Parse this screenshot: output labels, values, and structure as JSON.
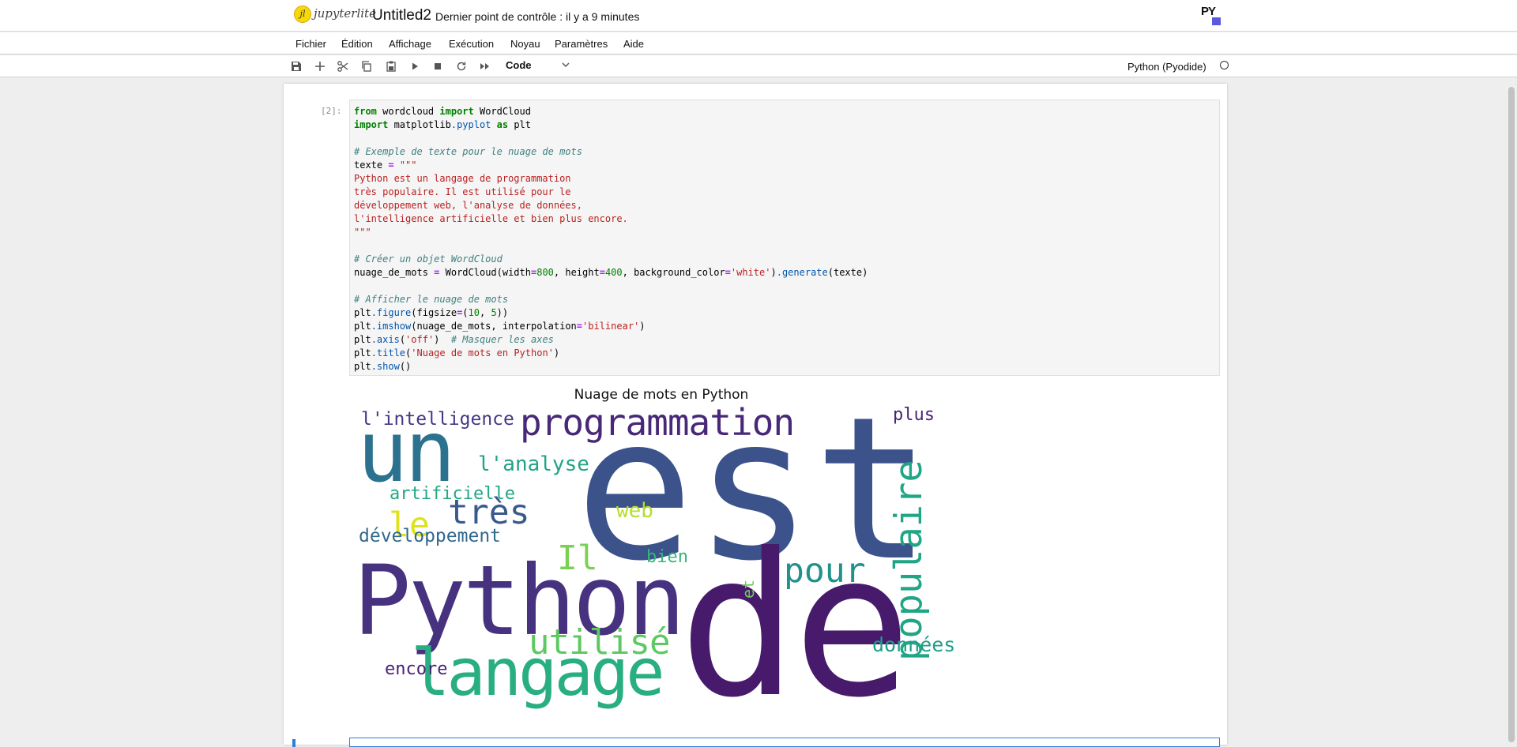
{
  "app": {
    "logo_text": "jupyterlite",
    "doc_title": "Untitled2",
    "checkpoint": "Dernier point de contrôle : il y a 9 minutes",
    "py_logo": "PY"
  },
  "menu": [
    "Fichier",
    "Édition",
    "Affichage",
    "Exécution",
    "Noyau",
    "Paramètres",
    "Aide"
  ],
  "toolbar": {
    "icons": [
      "save-icon",
      "add-icon",
      "cut-icon",
      "copy-icon",
      "paste-icon",
      "run-icon",
      "stop-icon",
      "restart-icon",
      "fast-forward-icon"
    ],
    "cell_type": "Code",
    "kernel_name": "Python (Pyodide)",
    "kernel_status": "idle"
  },
  "cell": {
    "prompt": "[2]:",
    "code_lines": [
      "from wordcloud import WordCloud",
      "import matplotlib.pyplot as plt",
      "",
      "# Exemple de texte pour le nuage de mots",
      "texte = \"\"\"",
      "Python est un langage de programmation",
      "très populaire. Il est utilisé pour le",
      "développement web, l'analyse de données,",
      "l'intelligence artificielle et bien plus encore.",
      "\"\"\"",
      "",
      "# Créer un objet WordCloud",
      "nuage_de_mots = WordCloud(width=800, height=400, background_color='white').generate(texte)",
      "",
      "# Afficher le nuage de mots",
      "plt.figure(figsize=(10, 5))",
      "plt.imshow(nuage_de_mots, interpolation='bilinear')",
      "plt.axis('off')  # Masquer les axes",
      "plt.title('Nuage de mots en Python')",
      "plt.show()"
    ]
  },
  "figure": {
    "title": "Nuage de mots en Python",
    "words": [
      {
        "text": "est",
        "color": "#3b528b"
      },
      {
        "text": "de",
        "color": "#481a6c"
      },
      {
        "text": "Python",
        "color": "#46327e"
      },
      {
        "text": "un",
        "color": "#2c728e"
      },
      {
        "text": "langage",
        "color": "#28ae80"
      },
      {
        "text": "programmation",
        "color": "#482878"
      },
      {
        "text": "populaire",
        "color": "#21a685"
      },
      {
        "text": "utilisé",
        "color": "#5ec962"
      },
      {
        "text": "pour",
        "color": "#21918c"
      },
      {
        "text": "très",
        "color": "#38598c"
      },
      {
        "text": "Il",
        "color": "#7ad151"
      },
      {
        "text": "le",
        "color": "#dde318"
      },
      {
        "text": "l'analyse",
        "color": "#20a386"
      },
      {
        "text": "l'intelligence",
        "color": "#453781"
      },
      {
        "text": "artificielle",
        "color": "#22a884"
      },
      {
        "text": "développement",
        "color": "#31688e"
      },
      {
        "text": "web",
        "color": "#b5de2b"
      },
      {
        "text": "bien",
        "color": "#35b779"
      },
      {
        "text": "plus",
        "color": "#482475"
      },
      {
        "text": "données",
        "color": "#1f9e89"
      },
      {
        "text": "encore",
        "color": "#482173"
      },
      {
        "text": "et",
        "color": "#6ccd5a"
      }
    ]
  },
  "colors": {
    "accent": "#2f7fd4",
    "code_background": "#f5f5f5",
    "keyword": "#008000",
    "string": "#ba2121",
    "comment": "#408080",
    "operator": "#aa22ff"
  }
}
